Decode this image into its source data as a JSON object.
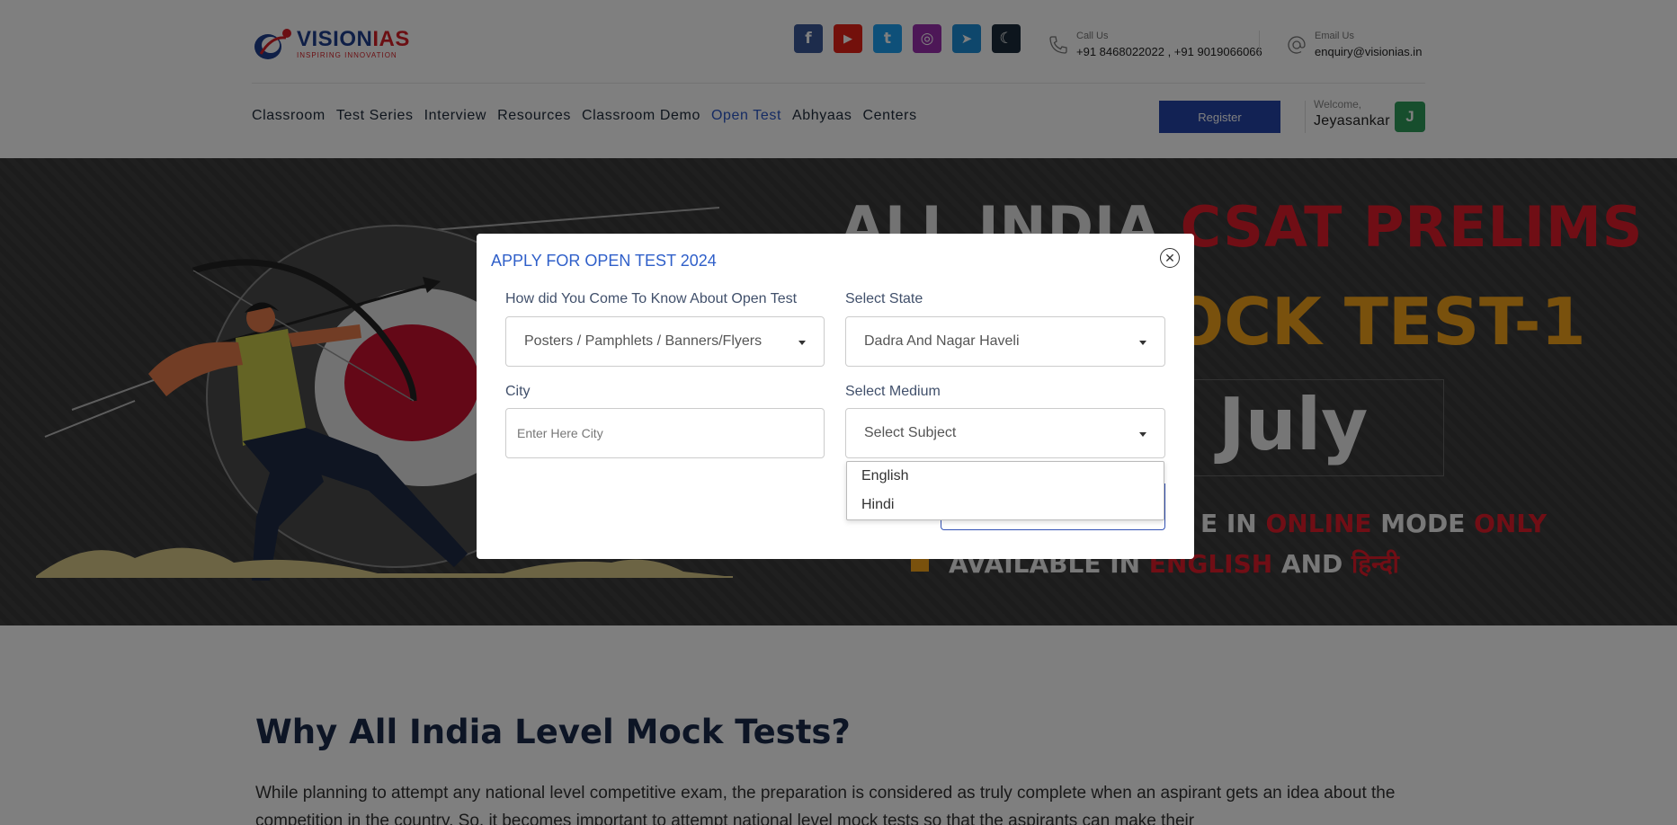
{
  "brand": {
    "name_a": "VISION",
    "name_b": "IAS",
    "tagline": "INSPIRING INNOVATION"
  },
  "socials": [
    {
      "name": "facebook",
      "glyph": "f",
      "color": "#3b5998"
    },
    {
      "name": "youtube",
      "glyph": "▶",
      "color": "#e62117"
    },
    {
      "name": "twitter",
      "glyph": "t",
      "color": "#1da1f2"
    },
    {
      "name": "instagram",
      "glyph": "◎",
      "color": "#9b2fae"
    },
    {
      "name": "telegram",
      "glyph": "➤",
      "color": "#1c8fd9"
    },
    {
      "name": "dark-mode",
      "glyph": "☾",
      "color": "#1b2b3a"
    }
  ],
  "contact": {
    "call_label": "Call Us",
    "call_value": "+91 8468022022 , +91 9019066066",
    "email_label": "Email Us",
    "email_value": "enquiry@visionias.in"
  },
  "nav": {
    "items": [
      "Classroom",
      "Test Series",
      "Interview",
      "Resources",
      "Classroom Demo",
      "Open Test",
      "Abhyaas",
      "Centers"
    ],
    "active": "Open Test"
  },
  "user": {
    "register_label": "Register",
    "welcome_label": "Welcome,",
    "name": "Jeyasankar",
    "avatar_initial": "J"
  },
  "banner": {
    "line1_a": "ALL INDIA ",
    "line1_b": "CSAT PRELIMS",
    "line2": "OCK TEST-1",
    "date": "July",
    "line4_a": "E IN ",
    "line4_b": "ONLINE",
    "line4_c": " MODE ",
    "line4_d": "ONLY",
    "line5_a": "AVAILABLE IN ",
    "line5_b": "ENGLISH",
    "line5_c": " AND ",
    "line5_d": "हिन्दी"
  },
  "content": {
    "heading": "Why All India Level Mock Tests?",
    "paragraph": "While planning to attempt any national level competitive exam, the preparation is considered as truly complete when an aspirant gets an idea about the competition in the country. So, it becomes important to attempt national level mock tests so that the aspirants can make their"
  },
  "modal": {
    "title": "APPLY FOR OPEN TEST 2024",
    "source_label": "How did You Come To Know About Open Test",
    "source_value": "Posters / Pamphlets / Banners/Flyers",
    "state_label": "Select State",
    "state_value": "Dadra And Nagar Haveli",
    "city_label": "City",
    "city_placeholder": "Enter Here City",
    "medium_label": "Select Medium",
    "medium_value": "Select Subject",
    "medium_options": [
      "English",
      "Hindi"
    ]
  }
}
